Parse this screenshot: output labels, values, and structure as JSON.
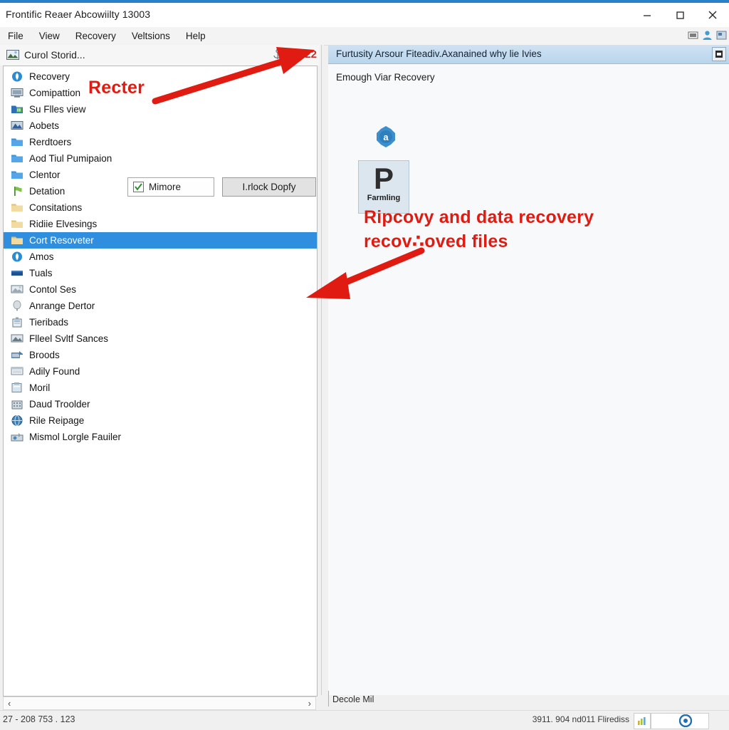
{
  "window": {
    "title": "Frontific Reaer Abcowiilty 13003",
    "accent_color": "#2a7fc9",
    "controls": [
      {
        "name": "minimize",
        "glyph": "minimize-icon"
      },
      {
        "name": "maximize",
        "glyph": "maximize-icon"
      },
      {
        "name": "close",
        "glyph": "close-icon"
      }
    ]
  },
  "menubar": {
    "items": [
      {
        "label": "File"
      },
      {
        "label": "View"
      },
      {
        "label": "Recovery"
      },
      {
        "label": "Veltsions"
      },
      {
        "label": "Help"
      }
    ],
    "right_icons": [
      "window-icon",
      "user-icon",
      "app-icon"
    ]
  },
  "toolbar": {
    "icon": "image-icon",
    "label": "Curol Storid...",
    "right_label": "Fluy",
    "right_count": "22",
    "right_icon": "anchor-icon"
  },
  "tree": {
    "items": [
      {
        "label": "Recovery",
        "icon": "circle-blue-icon",
        "selected": false
      },
      {
        "label": "Comipattion",
        "icon": "monitor-icon",
        "selected": false
      },
      {
        "label": "Su Flles view",
        "icon": "folder-green-icon",
        "selected": false
      },
      {
        "label": "Aobets",
        "icon": "mountain-icon",
        "selected": false
      },
      {
        "label": "Rerdtoers",
        "icon": "folder-blue-icon",
        "selected": false
      },
      {
        "label": "Aod Tiul Pumipaion",
        "icon": "folder-blue-icon",
        "selected": false
      },
      {
        "label": "Clentor",
        "icon": "folder-blue-icon",
        "selected": false
      },
      {
        "label": "Detation",
        "icon": "flag-green-icon",
        "selected": false
      },
      {
        "label": "Consitations",
        "icon": "folder-yellow-icon",
        "selected": false
      },
      {
        "label": "Ridiie Elvesings",
        "icon": "folder-yellow-icon",
        "selected": false
      },
      {
        "label": "Cort Resoveter",
        "icon": "folder-yellow-icon",
        "selected": true
      },
      {
        "label": "Amos",
        "icon": "circle-blue-icon",
        "selected": false
      },
      {
        "label": "Tuals",
        "icon": "bar-blue-icon",
        "selected": false
      },
      {
        "label": "Contol Ses",
        "icon": "picture-icon",
        "selected": false
      },
      {
        "label": "Anrange Dertor",
        "icon": "balloon-icon",
        "selected": false
      },
      {
        "label": "Tieribads",
        "icon": "device-icon",
        "selected": false
      },
      {
        "label": "Flleel Svltf Sances",
        "icon": "photo-icon",
        "selected": false
      },
      {
        "label": "Broods",
        "icon": "export-icon",
        "selected": false
      },
      {
        "label": "Adily Found",
        "icon": "window-grey-icon",
        "selected": false
      },
      {
        "label": "Moril",
        "icon": "clipboard-icon",
        "selected": false
      },
      {
        "label": "Daud Troolder",
        "icon": "building-icon",
        "selected": false
      },
      {
        "label": "Rile Reipage",
        "icon": "globe-icon",
        "selected": false
      },
      {
        "label": "Mismol Lorgle Fauiler",
        "icon": "tool-icon",
        "selected": false
      }
    ]
  },
  "buttons": {
    "mirror": {
      "label": "Mimore",
      "icon": "checkbox-green-icon"
    },
    "unlock": {
      "label": "I.rlock Dopfy"
    }
  },
  "hscroll": {
    "left_arrow": "‹",
    "right_arrow": "›"
  },
  "right_panel": {
    "header_title": "Furtusity  Arsour Fiteadiv.Axanained why lie Ivies",
    "header_button": "dialog-icon",
    "subtitle": "Emough Viar Recovery",
    "badge": "badge-a-icon",
    "tile": {
      "glyph": "P",
      "caption": "Farmling"
    },
    "footer_text": "Decole Mil"
  },
  "annotations": {
    "label_recter": "Recter",
    "callout_line1": "Ripcovy and data recovery",
    "callout_line2": "recov∴oved files",
    "color": "#e01b12"
  },
  "statusbar": {
    "left_text": "27 - 208 753 . 123",
    "right_text": "3911. 904 nd011 Flirediss",
    "icon_chart": "chart-icon",
    "icon_target": "target-icon"
  }
}
